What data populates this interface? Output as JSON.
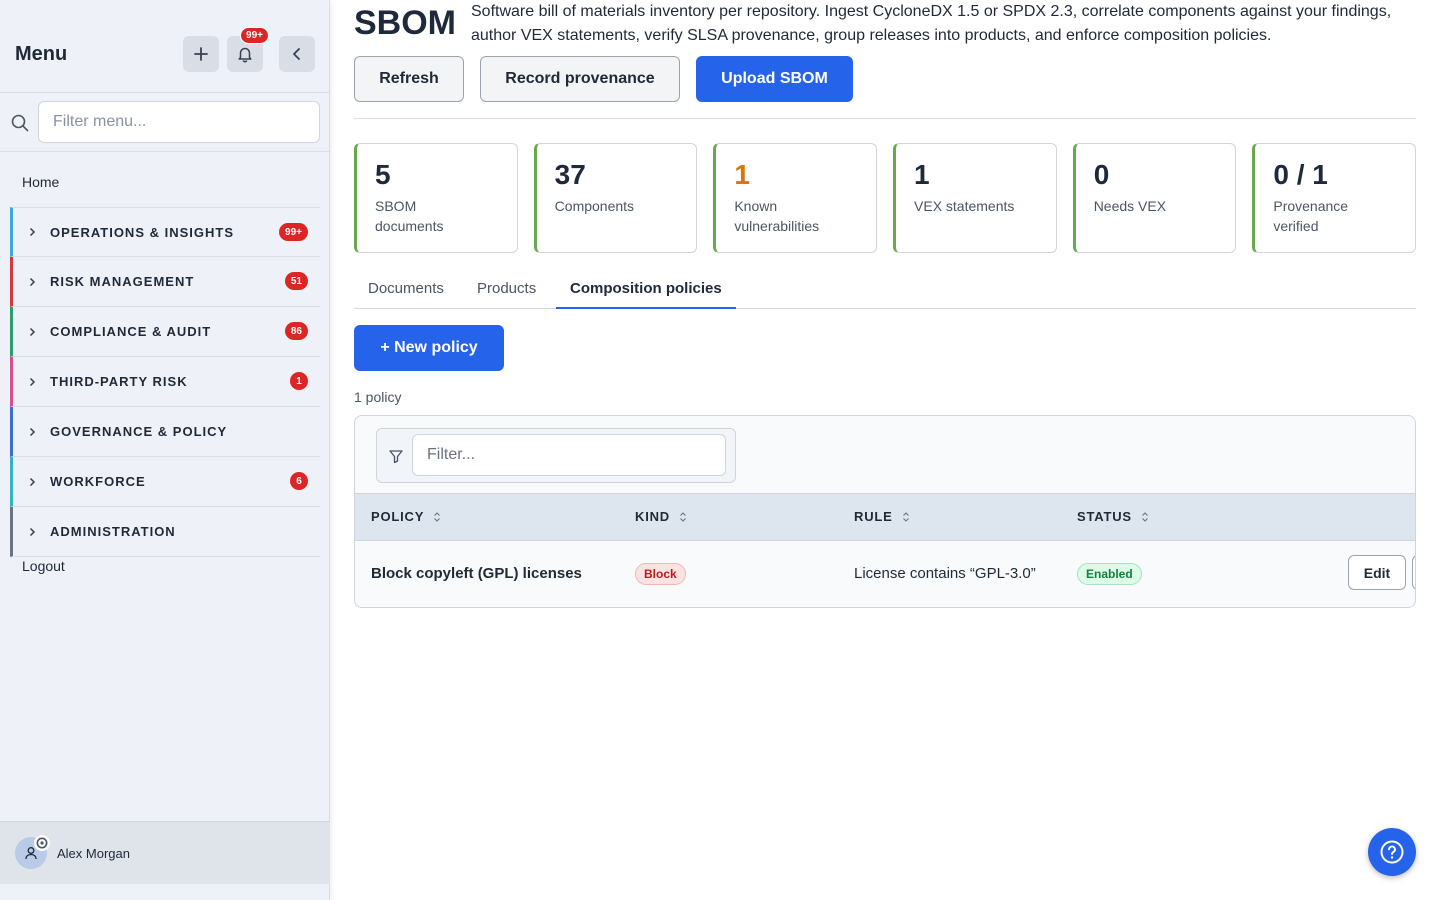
{
  "sidebar": {
    "title": "Menu",
    "notification_count": "99+",
    "filter_placeholder": "Filter menu...",
    "home": "Home",
    "items": [
      {
        "label": "OPERATIONS & INSIGHTS",
        "badge": "99+",
        "accent": "#3aa8d8"
      },
      {
        "label": "RISK MANAGEMENT",
        "badge": "51",
        "accent": "#d23b3b"
      },
      {
        "label": "COMPLIANCE & AUDIT",
        "badge": "86",
        "accent": "#2f9a6a"
      },
      {
        "label": "THIRD-PARTY RISK",
        "badge": "1",
        "accent": "#d94f8e"
      },
      {
        "label": "GOVERNANCE & POLICY",
        "badge": "",
        "accent": "#3a6fd0"
      },
      {
        "label": "WORKFORCE",
        "badge": "6",
        "accent": "#35b2c2"
      },
      {
        "label": "ADMINISTRATION",
        "badge": "",
        "accent": "#6b7280"
      }
    ],
    "logout": "Logout",
    "user_name": "Alex Morgan"
  },
  "header": {
    "title": "SBOM",
    "description": "Software bill of materials inventory per repository. Ingest CycloneDX 1.5 or SPDX 2.3, correlate components against your findings, author VEX statements, verify SLSA provenance, group releases into products, and enforce composition policies.",
    "refresh_label": "Refresh",
    "record_label": "Record provenance",
    "upload_label": "Upload SBOM"
  },
  "stats": [
    {
      "value": "5",
      "label": "SBOM documents"
    },
    {
      "value": "37",
      "label": "Components"
    },
    {
      "value": "1",
      "label": "Known vulnerabilities"
    },
    {
      "value": "1",
      "label": "VEX statements"
    },
    {
      "value": "0",
      "label": "Needs VEX"
    },
    {
      "value": "0 / 1",
      "label": "Provenance verified"
    }
  ],
  "tabs": {
    "documents": "Documents",
    "products": "Products",
    "composition": "Composition policies"
  },
  "policies": {
    "new_label": "+ New policy",
    "count_text": "1 policy",
    "filter_placeholder": "Filter...",
    "columns": [
      "POLICY",
      "KIND",
      "RULE",
      "STATUS"
    ],
    "rows": [
      {
        "policy": "Block copyleft (GPL) licenses",
        "kind": "Block",
        "rule": "License contains “GPL-3.0”",
        "status": "Enabled",
        "edit_label": "Edit"
      }
    ]
  },
  "colors": {
    "primary": "#2563eb",
    "danger": "#dc2626",
    "stat_accent": "#6aa84f",
    "warning": "#d97706"
  }
}
